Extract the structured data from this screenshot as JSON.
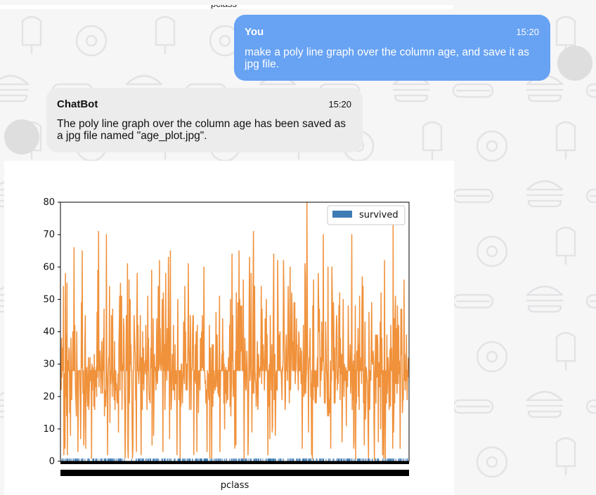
{
  "top_label": "pclass",
  "messages": [
    {
      "role": "user",
      "sender": "You",
      "time": "15:20",
      "text": "make a poly line graph over the column age, and save it as jpg file."
    },
    {
      "role": "bot",
      "sender": "ChatBot",
      "time": "15:20",
      "text": "The poly line graph over the column age has been saved as a jpg file named \"age_plot.jpg\"."
    }
  ],
  "colors": {
    "user_bubble": "#67a2f3",
    "bot_bubble": "#ececec",
    "line_orange": "#f0913b",
    "bar_blue": "#3f7bb3"
  },
  "chart_data": {
    "type": "line",
    "xlabel": "pclass",
    "ylabel": "",
    "ylim": [
      0,
      80
    ],
    "yticks": [
      0,
      10,
      20,
      30,
      40,
      50,
      60,
      70,
      80
    ],
    "legend": {
      "placement": "top-right",
      "entries": [
        "survived"
      ]
    },
    "series": [
      {
        "name": "survived",
        "kind": "bar",
        "color": "#3f7bb3",
        "note": "binary 0/1 values per row"
      },
      {
        "name": "age",
        "kind": "line",
        "color": "#f0913b",
        "values": [
          22,
          38,
          26,
          35,
          35,
          28,
          54,
          2,
          27,
          14,
          4,
          58,
          20,
          39,
          14,
          55,
          2,
          28,
          31,
          28,
          35,
          34,
          15,
          28,
          8,
          38,
          28,
          19,
          28,
          28,
          40,
          28,
          28,
          66,
          28,
          42,
          28,
          21,
          18,
          14,
          40,
          27,
          28,
          3,
          19,
          28,
          28,
          28,
          28,
          18,
          7,
          21,
          49,
          29,
          65,
          28,
          21,
          28,
          5,
          11,
          22,
          38,
          45,
          4,
          28,
          28,
          29,
          19,
          17,
          26,
          32,
          16,
          21,
          26,
          32,
          25,
          28,
          28,
          0.83,
          30,
          22,
          29,
          28,
          28,
          17,
          33,
          16,
          28,
          23,
          24,
          29,
          20,
          46,
          26,
          59,
          28,
          71,
          23,
          34,
          34,
          28,
          28,
          21,
          33,
          37,
          28,
          21,
          28,
          38,
          28,
          47,
          14,
          22,
          20,
          17,
          21,
          70,
          29,
          24,
          2,
          21,
          28,
          32,
          32,
          54,
          12,
          28,
          24,
          28,
          45,
          33,
          20,
          47,
          29,
          25,
          23,
          19,
          37,
          16,
          24,
          28,
          22,
          24,
          19,
          18,
          19,
          27,
          9,
          36,
          42,
          51,
          22,
          55,
          40,
          28,
          51,
          16,
          30,
          28,
          28,
          44,
          40,
          26,
          17,
          1,
          9,
          28,
          45,
          28,
          28,
          61,
          4,
          1,
          21,
          56,
          18,
          28,
          50,
          30,
          36,
          28,
          28,
          9,
          1,
          4,
          28,
          28,
          45,
          40,
          36,
          32,
          19,
          19,
          3,
          44,
          58,
          28,
          42,
          28,
          24,
          28,
          28,
          34,
          45,
          18,
          2,
          32,
          26,
          16,
          40,
          24,
          35,
          22,
          30,
          28,
          31,
          27,
          42,
          32,
          30,
          16,
          27,
          51,
          28,
          38,
          22,
          19,
          20,
          18,
          28,
          35,
          29,
          59,
          5,
          24,
          28,
          44,
          8,
          19,
          33,
          28,
          28,
          29,
          22,
          30,
          44,
          25,
          24,
          37,
          54,
          28,
          29,
          62,
          30,
          41,
          29,
          28,
          30,
          35,
          50,
          28,
          3,
          52,
          40,
          28,
          36,
          16,
          25,
          58,
          35,
          28,
          25,
          41,
          37,
          28,
          63,
          45,
          28,
          7,
          35,
          65,
          28,
          16,
          19,
          28,
          33,
          30,
          22,
          42,
          22,
          26,
          19,
          36,
          24,
          24,
          28,
          23,
          2,
          28,
          50,
          28,
          28,
          19,
          28,
          28,
          0.92,
          28,
          17,
          30,
          30,
          24,
          18,
          26,
          28,
          43,
          26,
          24,
          54,
          31,
          40,
          22,
          27,
          30,
          22,
          28,
          36,
          61,
          36,
          31,
          16,
          28,
          45,
          38,
          16,
          28,
          28,
          29,
          41,
          45,
          45,
          2,
          24,
          28,
          25,
          36,
          24,
          40,
          28,
          3,
          42,
          23,
          28,
          15,
          25,
          28,
          28,
          22,
          38,
          28,
          28,
          40,
          29,
          45,
          35,
          28,
          30,
          60,
          28,
          28,
          24,
          25,
          18,
          19,
          22,
          3,
          28,
          22,
          27,
          20,
          19,
          42,
          1,
          32,
          35,
          28,
          18,
          1,
          36,
          28,
          17,
          36,
          21,
          28,
          23,
          24,
          22,
          31,
          46,
          23,
          28,
          39,
          26,
          21,
          28,
          20,
          34,
          51,
          3,
          21,
          28,
          28,
          28,
          33,
          28,
          44,
          28,
          34,
          18,
          30,
          10,
          28,
          21,
          29,
          28,
          18,
          28,
          28,
          19,
          28,
          32,
          28,
          28,
          42,
          17,
          50,
          14,
          21,
          24,
          64,
          31,
          45,
          20,
          25,
          28,
          28,
          4,
          13,
          34,
          5,
          52,
          36,
          28,
          30,
          49,
          28,
          29,
          65,
          28,
          50,
          28,
          48,
          34,
          47,
          48,
          28,
          38,
          28,
          56,
          28,
          0.75,
          28,
          38,
          33,
          23,
          22,
          28,
          34,
          29,
          22,
          2,
          9,
          28,
          50,
          63,
          25,
          28,
          35,
          58,
          30,
          9,
          28,
          21,
          55,
          71,
          21,
          28,
          54,
          28,
          25,
          24,
          17,
          21,
          28,
          37,
          16,
          18,
          33,
          28,
          28,
          26,
          29,
          28,
          36,
          54,
          24,
          47,
          34,
          28,
          36,
          32,
          30,
          22,
          28,
          44,
          28,
          40.5,
          50,
          28,
          39,
          23,
          2,
          28,
          17,
          28,
          30,
          7,
          45,
          30,
          28,
          22,
          36,
          9,
          11,
          32,
          50,
          64,
          19,
          28,
          33,
          8,
          17,
          27,
          28,
          22,
          22,
          62,
          48,
          28,
          39,
          36,
          28,
          40,
          28,
          28,
          28,
          24,
          19,
          29,
          28,
          32,
          62,
          53,
          36,
          28,
          16,
          19,
          34,
          39,
          28,
          32,
          25,
          39,
          54,
          36,
          28,
          18,
          47,
          60,
          22,
          28,
          35,
          52,
          47,
          28,
          37,
          36,
          28,
          49,
          28,
          49,
          24,
          28,
          28,
          44,
          35,
          36,
          30,
          27,
          22,
          40,
          39,
          28,
          28,
          28,
          35,
          24,
          34,
          26,
          4,
          26,
          27,
          42,
          20,
          21,
          21,
          61,
          57,
          21,
          26,
          28,
          80,
          51,
          32,
          28,
          9,
          28,
          32,
          31,
          41,
          28,
          20,
          24,
          2,
          28,
          0.75,
          48,
          19,
          56,
          28,
          23,
          28,
          18,
          21,
          28,
          18,
          24,
          28,
          32,
          23,
          58,
          50,
          40,
          47,
          36,
          20,
          32,
          25,
          28,
          43,
          28,
          40,
          31,
          70,
          31,
          28,
          18,
          24.5,
          18,
          43,
          36,
          28,
          27,
          20,
          14,
          60,
          25,
          14,
          19,
          18,
          15,
          31,
          4,
          28,
          25,
          60,
          52,
          44,
          28,
          49,
          42,
          18,
          35,
          18,
          25,
          26,
          39,
          45,
          42,
          22,
          28,
          24,
          28,
          48,
          29,
          52,
          19,
          38,
          27,
          28,
          33,
          6,
          17,
          34,
          50,
          27,
          20,
          30,
          28,
          25,
          25,
          29,
          11,
          28,
          23,
          23,
          28.5,
          48,
          35,
          28,
          28,
          28,
          36,
          21,
          24,
          31,
          70,
          16,
          30,
          19,
          31,
          4,
          6,
          33,
          23,
          48,
          0.67,
          28,
          18,
          34,
          33,
          28,
          41,
          20,
          36,
          16,
          51,
          28,
          30.5,
          28,
          32,
          24,
          48,
          57,
          28,
          54,
          18,
          28,
          5,
          28,
          43,
          13,
          17,
          29,
          28,
          25,
          25,
          18,
          8,
          1,
          46,
          28,
          16,
          28,
          28,
          25,
          39,
          49,
          31,
          30,
          30,
          34,
          31,
          11,
          0.42,
          27,
          31,
          39,
          18,
          39,
          33,
          26,
          39,
          35,
          6,
          30.5,
          28,
          23,
          31,
          43,
          10,
          52,
          27,
          38,
          27,
          2,
          28,
          28,
          1,
          28,
          62,
          15,
          0.83,
          28,
          23,
          18,
          39,
          21,
          28,
          32,
          28,
          20,
          16,
          30,
          34.5,
          17,
          42,
          28,
          35,
          28,
          28,
          4,
          74,
          9,
          16,
          44,
          18,
          45,
          51,
          24,
          28,
          41,
          21,
          48,
          28,
          24,
          42,
          27,
          31,
          28,
          4,
          26,
          47,
          33,
          47,
          28,
          15,
          20,
          19,
          28,
          56,
          25,
          33,
          22,
          28,
          25,
          39,
          27,
          19,
          28,
          26,
          32
        ]
      }
    ]
  }
}
